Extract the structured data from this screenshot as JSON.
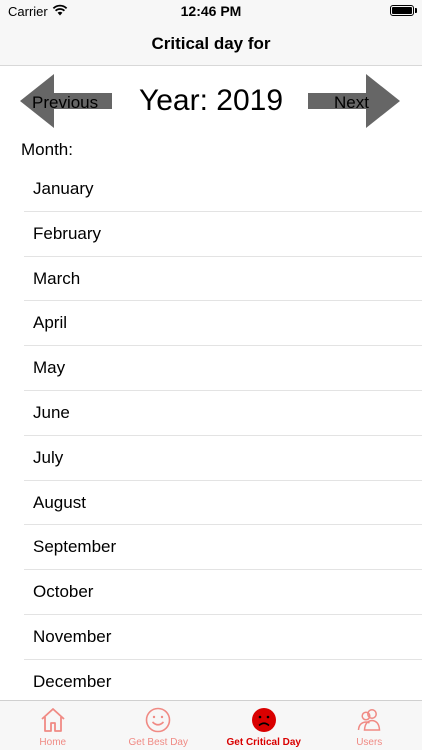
{
  "status_bar": {
    "carrier": "Carrier",
    "time": "12:46 PM",
    "icons": [
      "wifi-icon",
      "battery-icon"
    ]
  },
  "nav": {
    "title": "Critical day for"
  },
  "year_selector": {
    "previous_label": "Previous",
    "next_label": "Next",
    "year_text": "Year: 2019",
    "arrow_color": "#666666"
  },
  "month_heading": "Month:",
  "months": [
    "January",
    "February",
    "March",
    "April",
    "May",
    "June",
    "July",
    "August",
    "September",
    "October",
    "November",
    "December"
  ],
  "tabs": [
    {
      "label": "Home",
      "icon": "home-icon",
      "active": false
    },
    {
      "label": "Get Best Day",
      "icon": "smile-icon",
      "active": false
    },
    {
      "label": "Get Critical Day",
      "icon": "sad-face-icon",
      "active": true
    },
    {
      "label": "Users",
      "icon": "users-icon",
      "active": false
    }
  ],
  "colors": {
    "accent": "#d90000",
    "inactive_tab": "#f08a84"
  }
}
